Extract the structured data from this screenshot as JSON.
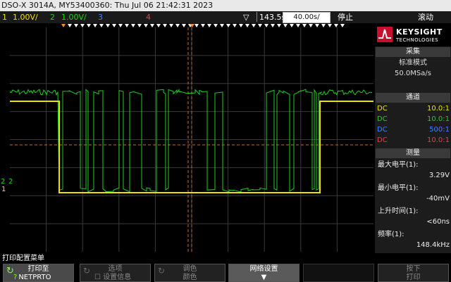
{
  "header": {
    "model_line": "DSO-X 3014A, MY53400360: Thu Jul 06 21:42:31 2023"
  },
  "channels": [
    {
      "num": "1",
      "scale": "1.00V/",
      "color": "#f0e000"
    },
    {
      "num": "2",
      "scale": "1.00V/",
      "color": "#20d020"
    },
    {
      "num": "3",
      "color": "#4080ff"
    },
    {
      "num": "4",
      "color": "#ff3050"
    }
  ],
  "timebase": {
    "delay": "143.5s",
    "scale": "40.00s/",
    "run_state": "停止",
    "mode": "滚动"
  },
  "brand": {
    "name": "KEYSIGHT",
    "sub": "TECHNOLOGIES"
  },
  "acquire": {
    "title": "采集",
    "mode": "标准模式",
    "rate": "50.0MSa/s"
  },
  "channel_panel": {
    "title": "通道",
    "rows": [
      {
        "coupling": "DC",
        "probe": "10.0:1",
        "color": "#f0e000"
      },
      {
        "coupling": "DC",
        "probe": "10.0:1",
        "color": "#20d020"
      },
      {
        "coupling": "DC",
        "probe": "500:1",
        "color": "#4080ff"
      },
      {
        "coupling": "DC",
        "probe": "10.0:1",
        "color": "#ff3050"
      }
    ]
  },
  "measure": {
    "title": "测量",
    "items": [
      {
        "label": "最大电平(1):",
        "value": "3.29V"
      },
      {
        "label": "最小电平(1):",
        "value": "-40mV"
      },
      {
        "label": "上升时间(1):",
        "value": "<60ns"
      },
      {
        "label": "频率(1):",
        "value": "148.4kHz"
      }
    ]
  },
  "softkey_menu": {
    "title": "打印配置菜单",
    "keys": [
      {
        "line1": "打印至",
        "line2": "NETPRTO"
      },
      {
        "line1": "选项",
        "line2": "设置信息"
      },
      {
        "line1": "调色",
        "line2": "颜色"
      },
      {
        "line1": "网络设置",
        "line2": ""
      },
      {
        "line1": "",
        "line2": ""
      },
      {
        "line1": "按下",
        "line2": "打印"
      }
    ]
  },
  "ground_markers": {
    "label": "2",
    "label_alt": "1"
  }
}
